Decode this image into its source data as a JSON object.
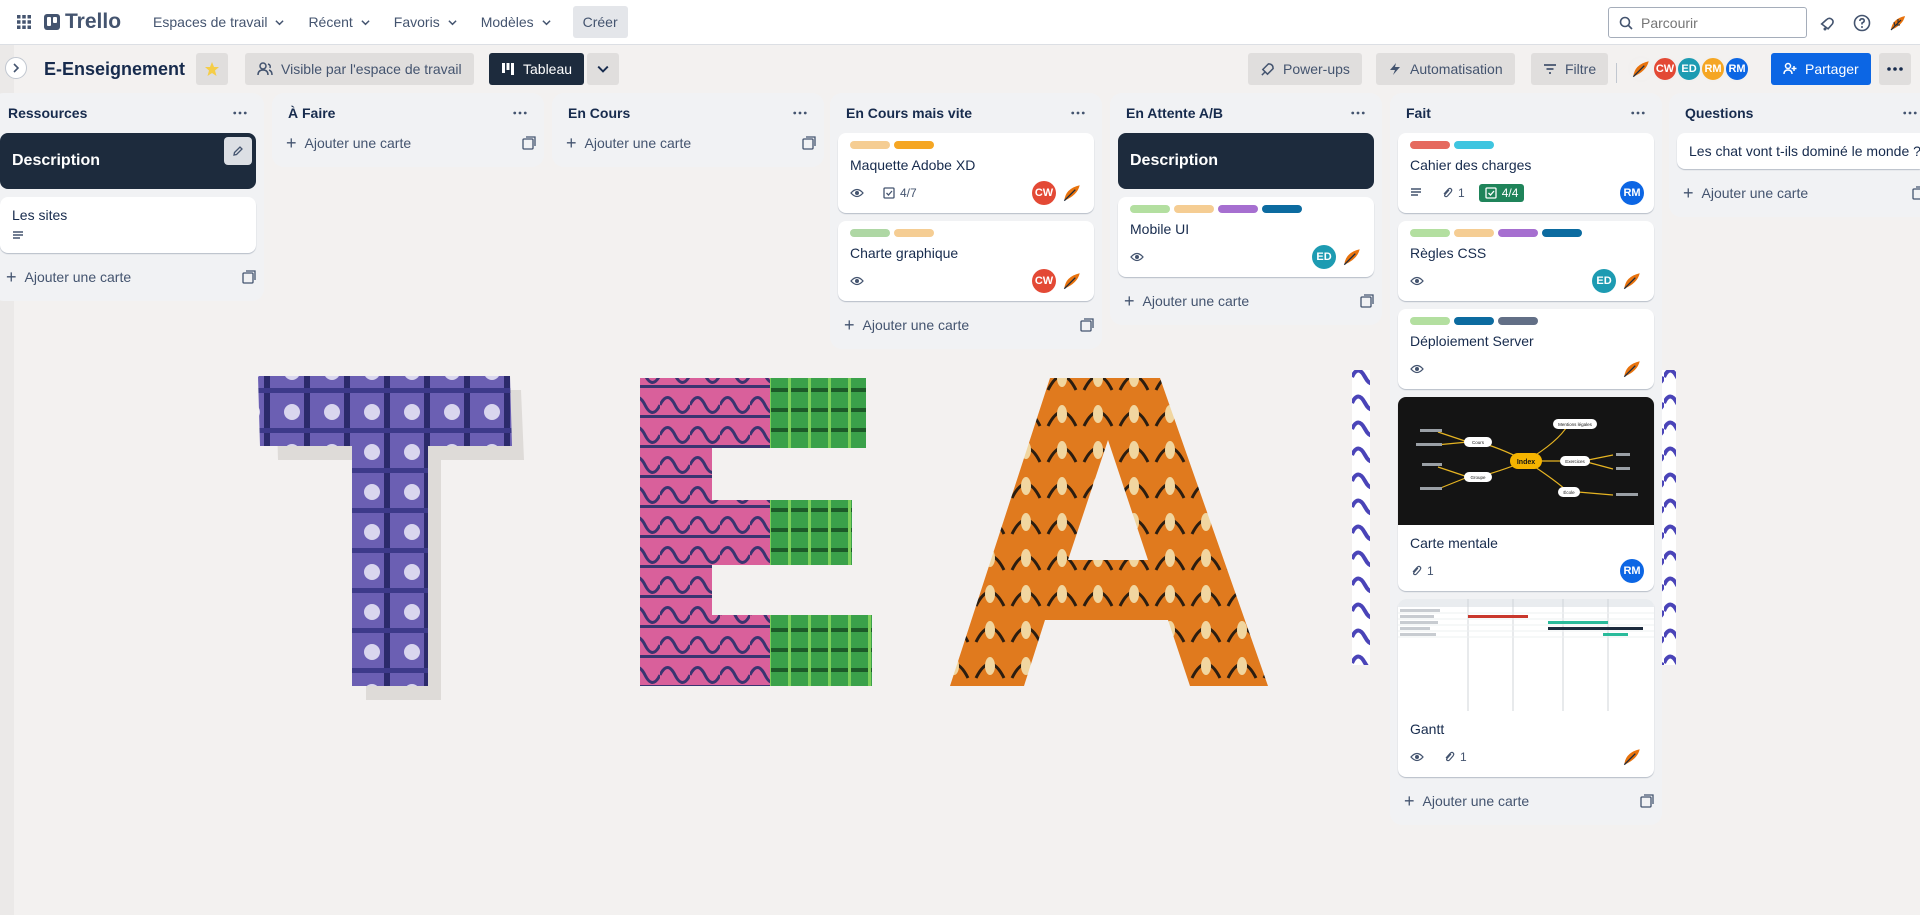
{
  "colors": {
    "accent": "#0c66e4",
    "board_dark": "#1d2b3d"
  },
  "topnav": {
    "brand": "Trello",
    "workspaces": "Espaces de travail",
    "recent": "Récent",
    "favorites": "Favoris",
    "templates": "Modèles",
    "create": "Créer",
    "search_placeholder": "Parcourir"
  },
  "board": {
    "title": "E-Enseignement",
    "visibility": "Visible par l'espace de travail",
    "view": "Tableau",
    "powerups": "Power-ups",
    "automation": "Automatisation",
    "filter": "Filtre",
    "share": "Partager",
    "members": [
      "CW",
      "ED",
      "RM",
      "RM"
    ]
  },
  "add_card_label": "Ajouter une carte",
  "lists": [
    {
      "title": "Ressources",
      "cover": "Description",
      "cards": [
        {
          "title": "Les sites",
          "description": true
        }
      ]
    },
    {
      "title": "À Faire"
    },
    {
      "title": "En Cours"
    },
    {
      "title": "En Cours mais vite",
      "cards": [
        {
          "title": "Maquette Adobe XD",
          "labels": [
            "#f5cd93",
            "#f5a623"
          ],
          "watch": true,
          "checklist": "4/7",
          "members": [
            "CW"
          ]
        },
        {
          "title": "Charte graphique",
          "labels": [
            "#aed7a4",
            "#f5cd93"
          ],
          "watch": true,
          "members": [
            "CW"
          ]
        }
      ]
    },
    {
      "title": "En Attente A/B",
      "cover": "Description",
      "cards": [
        {
          "title": "Mobile UI",
          "labels": [
            "#b3dfa0",
            "#f5cd93",
            "#a66fd0",
            "#0c6ba0"
          ],
          "watch": true,
          "members": [
            "ED"
          ]
        }
      ]
    },
    {
      "title": "Fait",
      "cards": [
        {
          "title": "Cahier des charges",
          "labels": [
            "#e56a5f",
            "#3fc5e0"
          ],
          "attachments": "1",
          "checklist": "4/4",
          "members": [
            "RM"
          ]
        },
        {
          "title": "Règles CSS",
          "labels": [
            "#b3dfa0",
            "#f5cd93",
            "#a66fd0",
            "#0c6ba0"
          ],
          "watch": true,
          "members": [
            "ED"
          ]
        },
        {
          "title": "Déploiement Server",
          "labels": [
            "#b3dfa0",
            "#0c6ba0",
            "#626f86"
          ],
          "watch": true
        },
        {
          "title": "Carte mentale",
          "attachments": "1",
          "members": [
            "RM"
          ],
          "mindmap": {
            "center": "Index",
            "nodes": [
              "Cours",
              "Groupe",
              "Exercices",
              "École",
              "Mentions légales"
            ]
          }
        },
        {
          "title": "Gantt",
          "watch": true,
          "attachments": "1"
        }
      ]
    },
    {
      "title": "Questions",
      "cards": [
        {
          "title": "Les chat vont t-ils dominé le monde ?"
        }
      ]
    }
  ]
}
